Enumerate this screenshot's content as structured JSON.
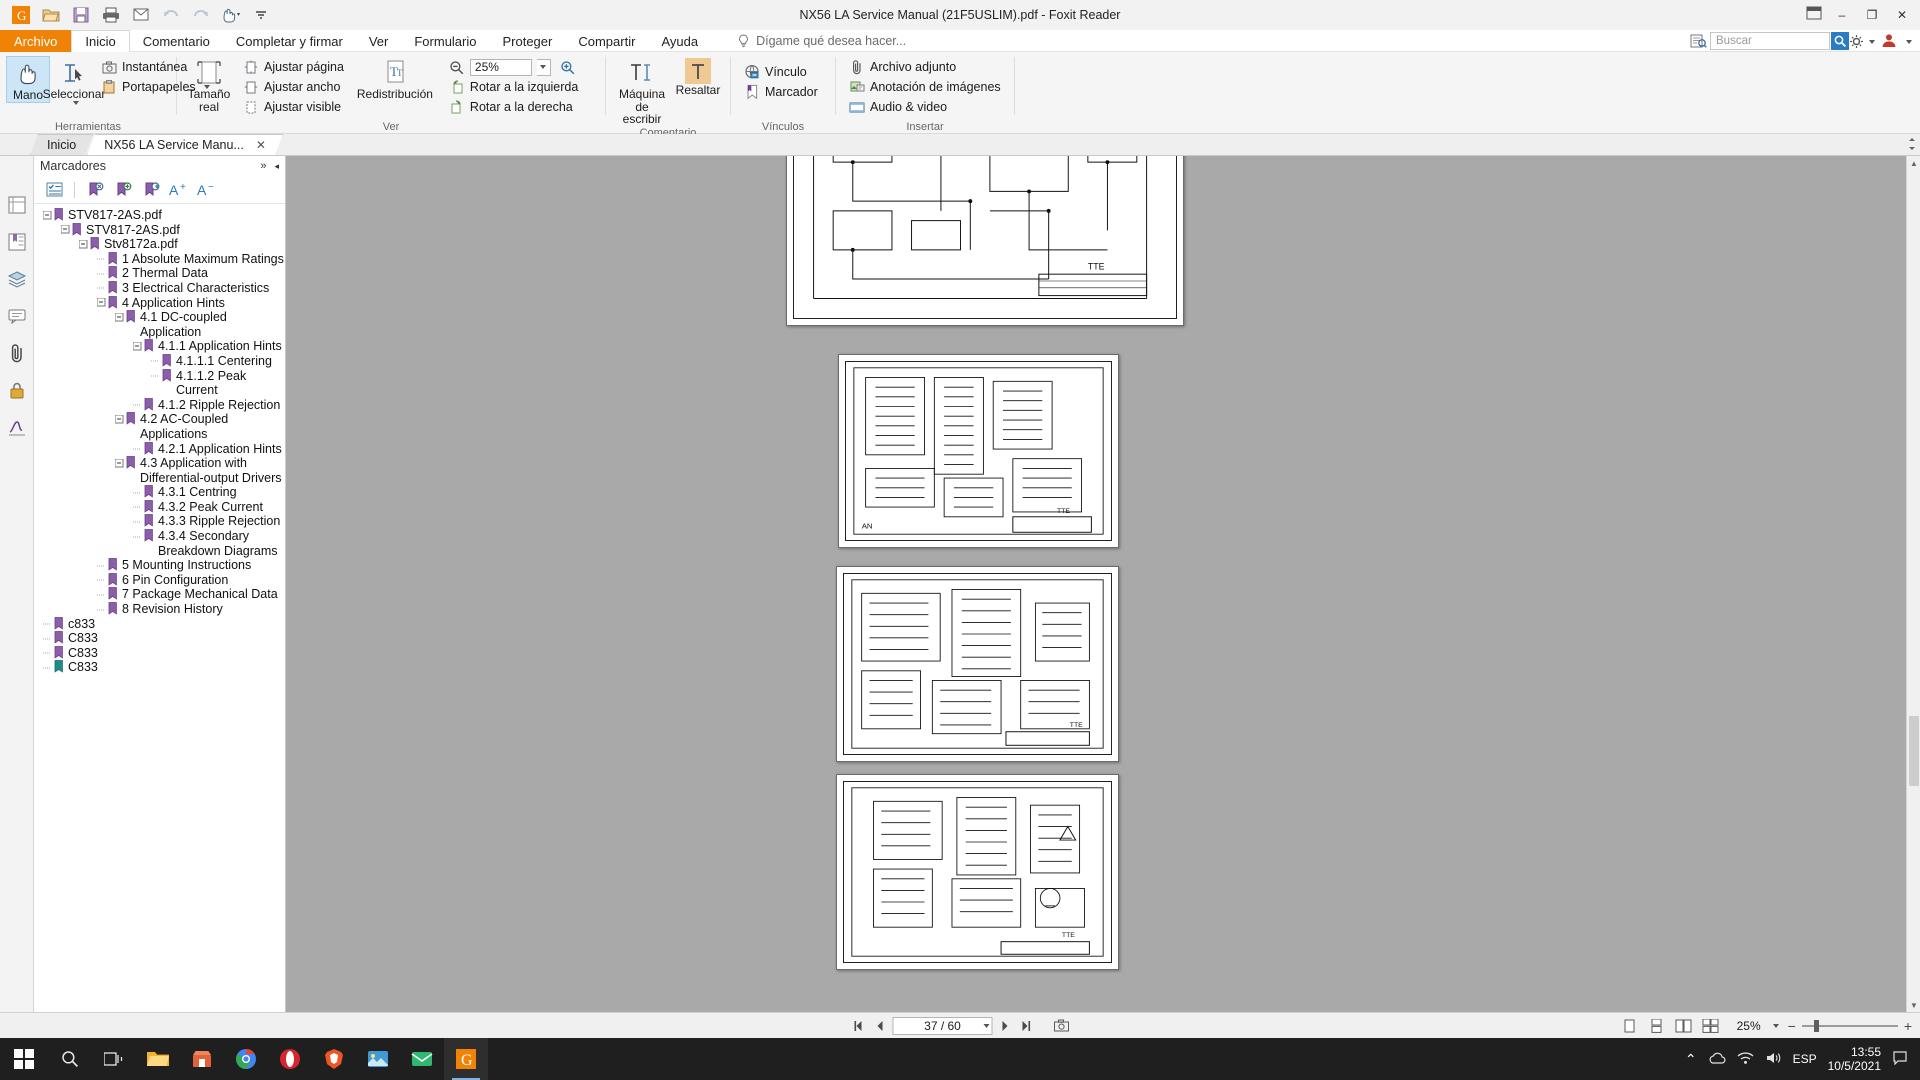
{
  "window": {
    "title": "NX56 LA Service Manual (21F5USLIM).pdf - Foxit Reader",
    "minimize": "–",
    "maximize": "❐",
    "close": "✕"
  },
  "quick_access": {
    "items": [
      {
        "name": "foxit-logo-icon",
        "label": "G"
      },
      {
        "name": "open-icon",
        "label": "Abrir"
      },
      {
        "name": "save-icon",
        "label": "Guardar"
      },
      {
        "name": "print-icon",
        "label": "Imprimir"
      },
      {
        "name": "email-icon",
        "label": "Correo"
      },
      {
        "name": "undo-icon",
        "label": "Deshacer"
      },
      {
        "name": "redo-icon",
        "label": "Rehacer"
      },
      {
        "name": "hand-tool-icon",
        "label": "Mano"
      }
    ]
  },
  "menu": {
    "file_tab": "Archivo",
    "tabs": [
      {
        "label": "Inicio",
        "active": true
      },
      {
        "label": "Comentario",
        "active": false
      },
      {
        "label": "Completar y firmar",
        "active": false
      },
      {
        "label": "Ver",
        "active": false
      },
      {
        "label": "Formulario",
        "active": false
      },
      {
        "label": "Proteger",
        "active": false
      },
      {
        "label": "Compartir",
        "active": false
      },
      {
        "label": "Ayuda",
        "active": false
      }
    ],
    "tell_me": "Dígame qué desea hacer...",
    "search_placeholder": "Buscar"
  },
  "ribbon": {
    "groups": [
      {
        "name": "Herramientas",
        "label": "Herramientas",
        "big_buttons": [
          {
            "label": "Mano",
            "icon": "hand-icon",
            "selected": true
          },
          {
            "label": "Seleccionar",
            "icon": "select-text-icon",
            "selected": false,
            "has_dropdown": true
          }
        ],
        "small_buttons": [
          {
            "label": "Instantánea",
            "icon": "snapshot-camera-icon"
          },
          {
            "label": "Portapapeles",
            "icon": "clipboard-icon",
            "has_dropdown": true
          }
        ]
      },
      {
        "name": "Ver",
        "label": "Ver",
        "big_buttons": [
          {
            "label": "Tamaño real",
            "icon": "actual-size-icon",
            "selected": false
          },
          {
            "label": "Redistribución",
            "icon": "reflow-icon",
            "selected": false
          }
        ],
        "small_buttons": [
          {
            "label": "Ajustar página",
            "icon": "fit-page-icon"
          },
          {
            "label": "Ajustar ancho",
            "icon": "fit-width-icon"
          },
          {
            "label": "Ajustar visible",
            "icon": "fit-visible-icon"
          },
          {
            "label": "Rotar a la izquierda",
            "icon": "rotate-left-icon"
          },
          {
            "label": "Rotar a la derecha",
            "icon": "rotate-right-icon"
          }
        ],
        "zoom_value": "25%",
        "zoom_out_icon": "zoom-out-icon",
        "zoom_in_icon": "zoom-in-icon"
      },
      {
        "name": "Comentario",
        "label": "Comentario",
        "big_buttons": [
          {
            "label": "Máquina de escribir",
            "icon": "typewriter-icon",
            "selected": false
          },
          {
            "label": "Resaltar",
            "icon": "highlight-icon",
            "selected": false
          }
        ]
      },
      {
        "name": "Vínculos",
        "label": "Vínculos",
        "small_buttons": [
          {
            "label": "Vínculo",
            "icon": "link-icon"
          },
          {
            "label": "Marcador",
            "icon": "bookmark-add-icon"
          }
        ]
      },
      {
        "name": "Insertar",
        "label": "Insertar",
        "small_buttons": [
          {
            "label": "Archivo adjunto",
            "icon": "attachment-icon"
          },
          {
            "label": "Anotación de imágenes",
            "icon": "image-annotation-icon"
          },
          {
            "label": "Audio & video",
            "icon": "audio-video-icon"
          }
        ]
      }
    ]
  },
  "doc_tabs": [
    {
      "label": "Inicio",
      "active": false,
      "closable": false
    },
    {
      "label": "NX56 LA Service Manu...",
      "active": true,
      "closable": true,
      "close": "✕"
    }
  ],
  "left_rail": [
    {
      "name": "rail-item-pages",
      "icon": "page-thumbnails-icon"
    },
    {
      "name": "rail-item-bookmarks",
      "icon": "bookmarks-icon"
    },
    {
      "name": "rail-item-layers",
      "icon": "layers-icon"
    },
    {
      "name": "rail-item-comments",
      "icon": "comments-icon"
    },
    {
      "name": "rail-item-attachments",
      "icon": "paperclip-icon"
    },
    {
      "name": "rail-item-security",
      "icon": "lock-icon"
    },
    {
      "name": "rail-item-signatures",
      "icon": "signature-icon"
    }
  ],
  "bookmarks_panel": {
    "title": "Marcadores",
    "collapse_icon": "»",
    "hide_icon": "◂",
    "toolbar": [
      {
        "name": "bookmark-options-icon",
        "label": "Opciones"
      },
      {
        "name": "delete-bookmark-icon",
        "label": "Eliminar marcador"
      },
      {
        "name": "add-bookmark-icon",
        "label": "Nuevo marcador"
      },
      {
        "name": "edit-bookmark-icon",
        "label": "Editar marcador"
      },
      {
        "name": "increase-font-icon",
        "label": "A+"
      },
      {
        "name": "decrease-font-icon",
        "label": "A-"
      }
    ],
    "items": [
      {
        "label": "STV817-2AS.pdf",
        "depth": 0,
        "expander": "minus"
      },
      {
        "label": "STV817-2AS.pdf",
        "depth": 1,
        "expander": "minus"
      },
      {
        "label": "Stv8172a.pdf",
        "depth": 2,
        "expander": "minus"
      },
      {
        "label": "1 Absolute Maximum Ratings",
        "depth": 3,
        "expander": "leaf"
      },
      {
        "label": "2 Thermal Data",
        "depth": 3,
        "expander": "leaf"
      },
      {
        "label": "3 Electrical Characteristics",
        "depth": 3,
        "expander": "leaf"
      },
      {
        "label": "4 Application Hints",
        "depth": 3,
        "expander": "minus"
      },
      {
        "label": "4.1 DC-coupled Application",
        "depth": 4,
        "expander": "minus"
      },
      {
        "label": "4.1.1 Application Hints",
        "depth": 5,
        "expander": "minus"
      },
      {
        "label": "4.1.1.1 Centering",
        "depth": 6,
        "expander": "leaf"
      },
      {
        "label": "4.1.1.2 Peak Current",
        "depth": 6,
        "expander": "leaf"
      },
      {
        "label": "4.1.2 Ripple Rejection",
        "depth": 5,
        "expander": "leaf"
      },
      {
        "label": "4.2 AC-Coupled Applications",
        "depth": 4,
        "expander": "minus"
      },
      {
        "label": "4.2.1 Application Hints",
        "depth": 5,
        "expander": "leaf"
      },
      {
        "label": "4.3 Application with Differential-output Drivers",
        "depth": 4,
        "expander": "minus"
      },
      {
        "label": "4.3.1 Centring",
        "depth": 5,
        "expander": "leaf"
      },
      {
        "label": "4.3.2 Peak Current",
        "depth": 5,
        "expander": "leaf"
      },
      {
        "label": "4.3.3 Ripple Rejection",
        "depth": 5,
        "expander": "leaf"
      },
      {
        "label": "4.3.4 Secondary Breakdown Diagrams",
        "depth": 5,
        "expander": "leaf"
      },
      {
        "label": "5 Mounting Instructions",
        "depth": 3,
        "expander": "leaf"
      },
      {
        "label": "6 Pin Configuration",
        "depth": 3,
        "expander": "leaf"
      },
      {
        "label": "7 Package Mechanical Data",
        "depth": 3,
        "expander": "leaf"
      },
      {
        "label": "8 Revision History",
        "depth": 3,
        "expander": "leaf"
      },
      {
        "label": "c833",
        "depth": 0,
        "expander": "leaf"
      },
      {
        "label": "C833",
        "depth": 0,
        "expander": "leaf"
      },
      {
        "label": "C833",
        "depth": 0,
        "expander": "leaf"
      },
      {
        "label": "C833",
        "depth": 0,
        "expander": "leaf",
        "teal": true
      }
    ]
  },
  "status_bar": {
    "first_page_icon": "first-page-icon",
    "prev_page_icon": "previous-page-icon",
    "page_value": "37 / 60",
    "next_page_icon": "next-page-icon",
    "last_page_icon": "last-page-icon",
    "snapshot_icon": "snapshot-icon",
    "view_modes": [
      {
        "name": "single-page-view-icon",
        "selected": false
      },
      {
        "name": "continuous-view-icon",
        "selected": false
      },
      {
        "name": "facing-view-icon",
        "selected": false
      },
      {
        "name": "continuous-facing-view-icon",
        "selected": false
      }
    ],
    "zoom_level": "25%",
    "zoom_minus": "−",
    "zoom_plus": "+"
  },
  "taskbar": {
    "start_icon": "windows-start-icon",
    "search_icon": "taskbar-search-icon",
    "task_view_icon": "task-view-icon",
    "apps": [
      {
        "name": "file-explorer-icon",
        "color": "#f2b233",
        "active": false
      },
      {
        "name": "store-icon",
        "color": "#e0633a",
        "active": false
      },
      {
        "name": "chrome-icon",
        "color": "#4285f4",
        "active": false
      },
      {
        "name": "opera-icon",
        "color": "#d7252f",
        "active": false
      },
      {
        "name": "brave-icon",
        "color": "#f05523",
        "active": false
      },
      {
        "name": "photos-icon",
        "color": "#3f9ad6",
        "active": false
      },
      {
        "name": "mail-icon",
        "color": "#2eb872",
        "active": false
      },
      {
        "name": "foxit-reader-icon",
        "color": "#f08306",
        "active": true
      }
    ],
    "tray": {
      "chevron_up": "⌃",
      "network_icon": "network-icon",
      "volume_icon": "volume-icon",
      "language": "ESP",
      "time": "13:55",
      "date": "10/5/2021",
      "notification_icon": "notifications-icon"
    }
  }
}
